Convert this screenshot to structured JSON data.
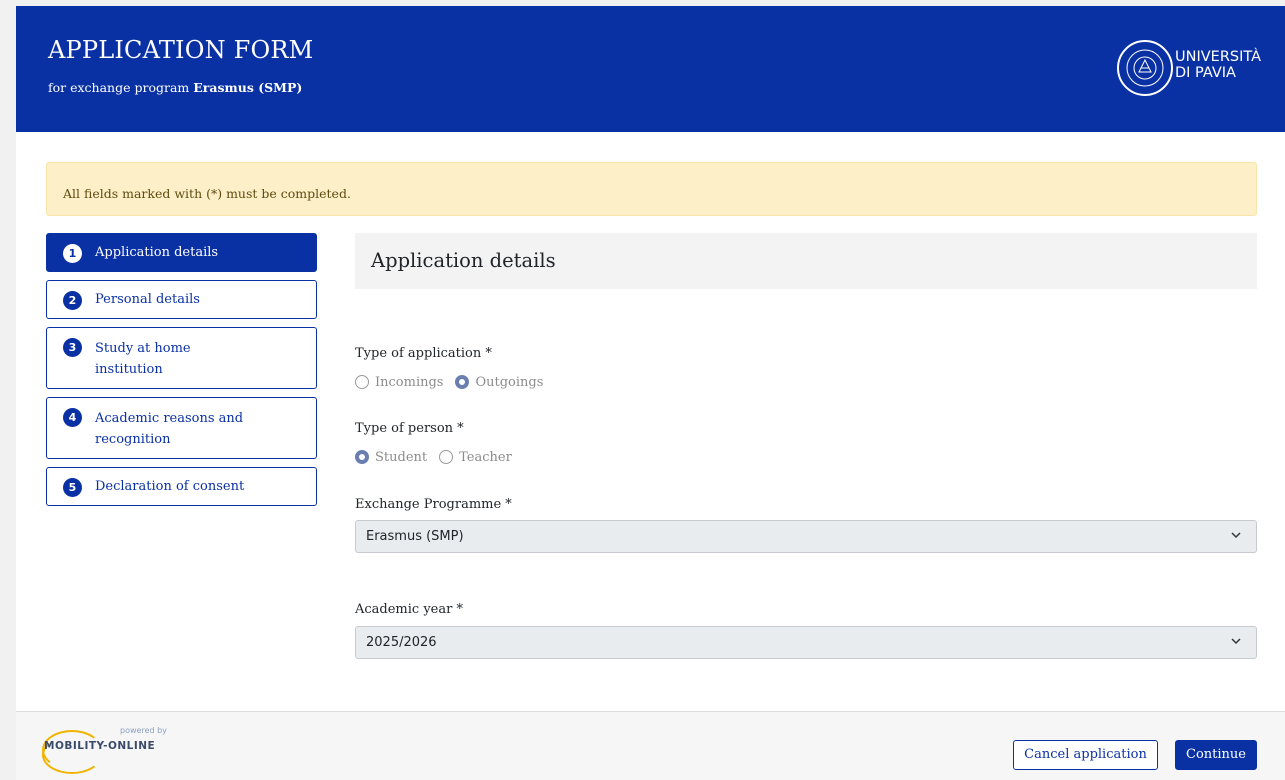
{
  "header": {
    "title": "APPLICATION FORM",
    "subtitle_prefix": "for exchange program",
    "program": "Erasmus (SMP)",
    "logo_line1": "UNIVERSITÀ",
    "logo_line2": "DI PAVIA"
  },
  "alert": {
    "text": "All fields marked with (*) must be completed."
  },
  "steps": [
    {
      "num": "1",
      "label": "Application details",
      "active": true
    },
    {
      "num": "2",
      "label": "Personal details",
      "active": false
    },
    {
      "num": "3",
      "label": "Study at home institution",
      "active": false
    },
    {
      "num": "4",
      "label": "Academic reasons and recognition",
      "active": false
    },
    {
      "num": "5",
      "label": "Declaration of consent",
      "active": false
    }
  ],
  "section": {
    "title": "Application details"
  },
  "form": {
    "type_of_application": {
      "label": "Type of application *",
      "options": [
        "Incomings",
        "Outgoings"
      ],
      "selected": "Outgoings"
    },
    "type_of_person": {
      "label": "Type of person *",
      "options": [
        "Student",
        "Teacher"
      ],
      "selected": "Student"
    },
    "exchange_programme": {
      "label": "Exchange Programme *",
      "value": "Erasmus (SMP)"
    },
    "academic_year": {
      "label": "Academic year *",
      "value": "2025/2026"
    }
  },
  "footer": {
    "powered_by": "powered by",
    "brand": "MOBILITY-ONLINE",
    "cancel_label": "Cancel application",
    "continue_label": "Continue"
  },
  "colors": {
    "brand_blue": "#0a31a4",
    "alert_bg": "#fdf0c8"
  }
}
